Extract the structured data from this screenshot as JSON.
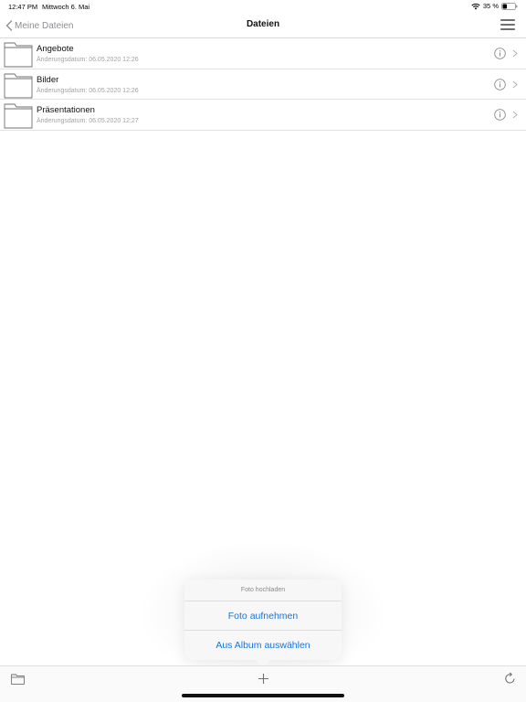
{
  "status_bar": {
    "time": "12:47 PM",
    "date": "Mittwoch 6. Mai",
    "battery": "35 %",
    "battery_level": 0.35
  },
  "nav": {
    "back_label": "Meine Dateien",
    "title": "Dateien"
  },
  "files": [
    {
      "name": "Angebote",
      "modified": "Änderungsdatum: 06.05.2020 12:26"
    },
    {
      "name": "Bilder",
      "modified": "Änderungsdatum: 06.05.2020 12:26"
    },
    {
      "name": "Präsentationen",
      "modified": "Änderungsdatum: 06.05.2020 12:27"
    }
  ],
  "popover": {
    "title": "Foto hochladen",
    "actions": [
      "Foto aufnehmen",
      "Aus Album auswählen"
    ]
  },
  "toolbar": {
    "icons": [
      "folder-icon",
      "plus-icon",
      "refresh-icon"
    ]
  },
  "colors": {
    "accent": "#1a73d8",
    "secondary_text": "#a3a3a3",
    "icon_gray": "#6f6f6f"
  }
}
